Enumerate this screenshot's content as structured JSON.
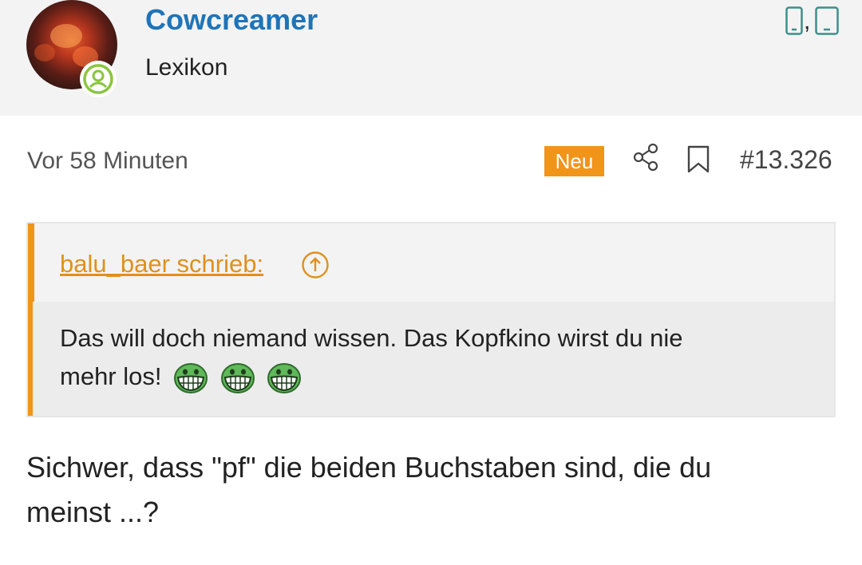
{
  "user": {
    "name": "Cowcreamer",
    "rank": "Lexikon"
  },
  "device_separator": ",",
  "post": {
    "time": "Vor 58 Minuten",
    "badge": "Neu",
    "number": "#13.326",
    "text_line1": "Sichwer, dass \"pf\" die beiden Buchstaben sind, die du",
    "text_line2": "meinst ...?"
  },
  "quote": {
    "author": "balu_baer schrieb:",
    "text_line1": "Das will doch niemand wissen. Das Kopfkino wirst du nie",
    "text_line2": "mehr los!"
  },
  "icons": {
    "online": "user-online-icon",
    "devices": [
      "smartphone-icon",
      "smartphone-icon"
    ],
    "share": "share-icon",
    "bookmark": "bookmark-icon",
    "quote_jump": "arrow-up-circle-icon",
    "emoji": "grinning-emoji"
  },
  "colors": {
    "username": "#1e74b8",
    "accent": "#f0941a",
    "online": "#8bc540",
    "header_bg": "#f3f3f3",
    "icon": "#3d8f8a"
  }
}
